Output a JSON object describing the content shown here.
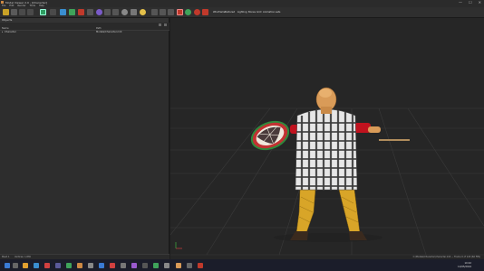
{
  "window": {
    "title": "Model Viewer 2.0 - [Character]",
    "minimize": "—",
    "maximize": "☐",
    "close": "✕"
  },
  "menu": [
    "File",
    "Edit",
    "Render",
    "Tools",
    "Help"
  ],
  "toolbar": {
    "labels": [
      "Wireframe",
      "Textured",
      "Lighting",
      "Bones",
      "Grid",
      "Animation sets"
    ]
  },
  "left_panel": {
    "title": "Objects",
    "columns": [
      "Name",
      "Path"
    ],
    "rows": [
      {
        "name": "Character",
        "path": "Models/Character.mdl"
      }
    ],
    "bottom": {
      "left": "Mesh 1",
      "right": "Vertices: 1,836"
    }
  },
  "viewport": {
    "status_path": "C:\\Models\\Character\\character.mdl  —  Frame 0 of 120  (60 FPS)"
  },
  "taskbar": {
    "time": "10:42",
    "date": "12/05/2024"
  },
  "colors": {
    "shield_rim": "#c23232",
    "tunic_check": "#e6e6e6",
    "tunic_dark": "#3c3c3c",
    "legs": "#d8a528",
    "skin": "#d99b58",
    "sleeve": "#c0121e"
  }
}
